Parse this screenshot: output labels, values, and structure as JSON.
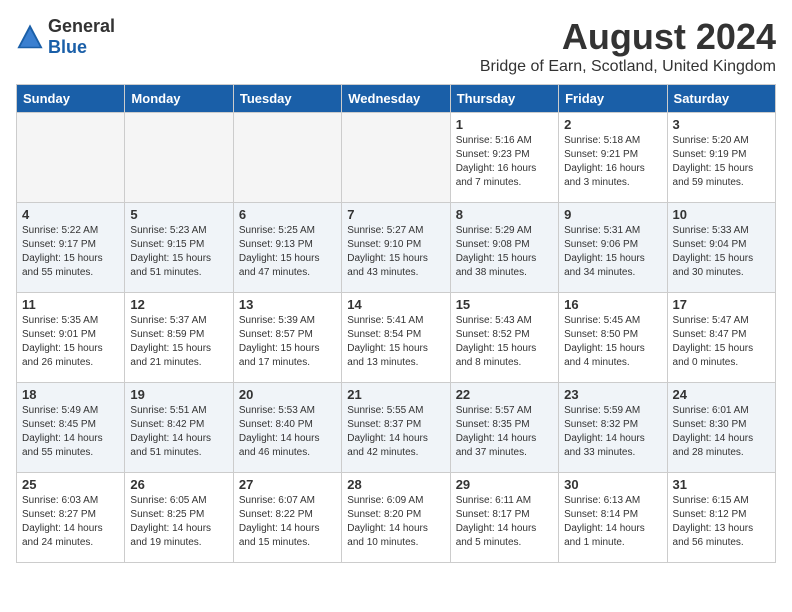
{
  "header": {
    "logo_general": "General",
    "logo_blue": "Blue",
    "month_year": "August 2024",
    "location": "Bridge of Earn, Scotland, United Kingdom"
  },
  "weekdays": [
    "Sunday",
    "Monday",
    "Tuesday",
    "Wednesday",
    "Thursday",
    "Friday",
    "Saturday"
  ],
  "weeks": [
    [
      {
        "day": "",
        "info": "",
        "empty": true
      },
      {
        "day": "",
        "info": "",
        "empty": true
      },
      {
        "day": "",
        "info": "",
        "empty": true
      },
      {
        "day": "",
        "info": "",
        "empty": true
      },
      {
        "day": "1",
        "info": "Sunrise: 5:16 AM\nSunset: 9:23 PM\nDaylight: 16 hours\nand 7 minutes."
      },
      {
        "day": "2",
        "info": "Sunrise: 5:18 AM\nSunset: 9:21 PM\nDaylight: 16 hours\nand 3 minutes."
      },
      {
        "day": "3",
        "info": "Sunrise: 5:20 AM\nSunset: 9:19 PM\nDaylight: 15 hours\nand 59 minutes."
      }
    ],
    [
      {
        "day": "4",
        "info": "Sunrise: 5:22 AM\nSunset: 9:17 PM\nDaylight: 15 hours\nand 55 minutes."
      },
      {
        "day": "5",
        "info": "Sunrise: 5:23 AM\nSunset: 9:15 PM\nDaylight: 15 hours\nand 51 minutes."
      },
      {
        "day": "6",
        "info": "Sunrise: 5:25 AM\nSunset: 9:13 PM\nDaylight: 15 hours\nand 47 minutes."
      },
      {
        "day": "7",
        "info": "Sunrise: 5:27 AM\nSunset: 9:10 PM\nDaylight: 15 hours\nand 43 minutes."
      },
      {
        "day": "8",
        "info": "Sunrise: 5:29 AM\nSunset: 9:08 PM\nDaylight: 15 hours\nand 38 minutes."
      },
      {
        "day": "9",
        "info": "Sunrise: 5:31 AM\nSunset: 9:06 PM\nDaylight: 15 hours\nand 34 minutes."
      },
      {
        "day": "10",
        "info": "Sunrise: 5:33 AM\nSunset: 9:04 PM\nDaylight: 15 hours\nand 30 minutes."
      }
    ],
    [
      {
        "day": "11",
        "info": "Sunrise: 5:35 AM\nSunset: 9:01 PM\nDaylight: 15 hours\nand 26 minutes."
      },
      {
        "day": "12",
        "info": "Sunrise: 5:37 AM\nSunset: 8:59 PM\nDaylight: 15 hours\nand 21 minutes."
      },
      {
        "day": "13",
        "info": "Sunrise: 5:39 AM\nSunset: 8:57 PM\nDaylight: 15 hours\nand 17 minutes."
      },
      {
        "day": "14",
        "info": "Sunrise: 5:41 AM\nSunset: 8:54 PM\nDaylight: 15 hours\nand 13 minutes."
      },
      {
        "day": "15",
        "info": "Sunrise: 5:43 AM\nSunset: 8:52 PM\nDaylight: 15 hours\nand 8 minutes."
      },
      {
        "day": "16",
        "info": "Sunrise: 5:45 AM\nSunset: 8:50 PM\nDaylight: 15 hours\nand 4 minutes."
      },
      {
        "day": "17",
        "info": "Sunrise: 5:47 AM\nSunset: 8:47 PM\nDaylight: 15 hours\nand 0 minutes."
      }
    ],
    [
      {
        "day": "18",
        "info": "Sunrise: 5:49 AM\nSunset: 8:45 PM\nDaylight: 14 hours\nand 55 minutes."
      },
      {
        "day": "19",
        "info": "Sunrise: 5:51 AM\nSunset: 8:42 PM\nDaylight: 14 hours\nand 51 minutes."
      },
      {
        "day": "20",
        "info": "Sunrise: 5:53 AM\nSunset: 8:40 PM\nDaylight: 14 hours\nand 46 minutes."
      },
      {
        "day": "21",
        "info": "Sunrise: 5:55 AM\nSunset: 8:37 PM\nDaylight: 14 hours\nand 42 minutes."
      },
      {
        "day": "22",
        "info": "Sunrise: 5:57 AM\nSunset: 8:35 PM\nDaylight: 14 hours\nand 37 minutes."
      },
      {
        "day": "23",
        "info": "Sunrise: 5:59 AM\nSunset: 8:32 PM\nDaylight: 14 hours\nand 33 minutes."
      },
      {
        "day": "24",
        "info": "Sunrise: 6:01 AM\nSunset: 8:30 PM\nDaylight: 14 hours\nand 28 minutes."
      }
    ],
    [
      {
        "day": "25",
        "info": "Sunrise: 6:03 AM\nSunset: 8:27 PM\nDaylight: 14 hours\nand 24 minutes."
      },
      {
        "day": "26",
        "info": "Sunrise: 6:05 AM\nSunset: 8:25 PM\nDaylight: 14 hours\nand 19 minutes."
      },
      {
        "day": "27",
        "info": "Sunrise: 6:07 AM\nSunset: 8:22 PM\nDaylight: 14 hours\nand 15 minutes."
      },
      {
        "day": "28",
        "info": "Sunrise: 6:09 AM\nSunset: 8:20 PM\nDaylight: 14 hours\nand 10 minutes."
      },
      {
        "day": "29",
        "info": "Sunrise: 6:11 AM\nSunset: 8:17 PM\nDaylight: 14 hours\nand 5 minutes."
      },
      {
        "day": "30",
        "info": "Sunrise: 6:13 AM\nSunset: 8:14 PM\nDaylight: 14 hours\nand 1 minute."
      },
      {
        "day": "31",
        "info": "Sunrise: 6:15 AM\nSunset: 8:12 PM\nDaylight: 13 hours\nand 56 minutes."
      }
    ]
  ],
  "colors": {
    "header_bg": "#1a5fa8",
    "row_odd_bg": "#ffffff",
    "row_even_bg": "#f0f4f8",
    "empty_bg": "#f5f5f5"
  }
}
